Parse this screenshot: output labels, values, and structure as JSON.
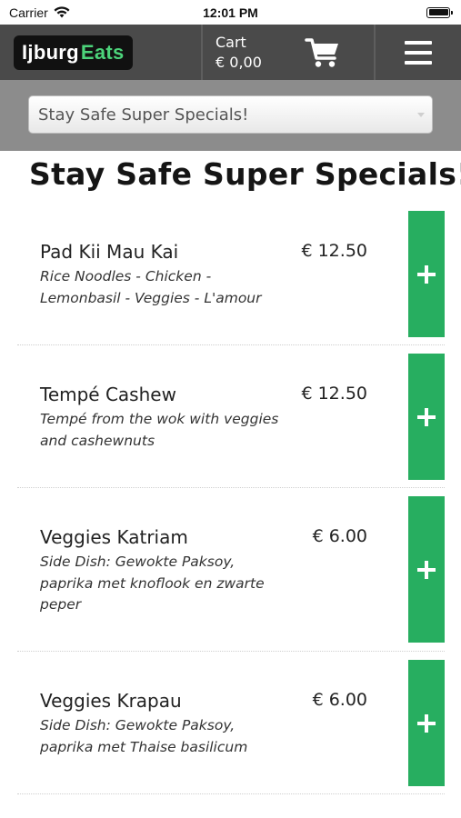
{
  "status_bar": {
    "carrier": "Carrier",
    "time": "12:01 PM"
  },
  "header": {
    "logo_part1": "Ijburg",
    "logo_part2": "Eats",
    "cart_label": "Cart",
    "cart_total": "€ 0,00",
    "icons": [
      "cart-icon",
      "menu-icon"
    ]
  },
  "category": {
    "selected": "Stay Safe Super Specials!"
  },
  "page_title": "Stay Safe Super Specials!",
  "products": [
    {
      "name": "Pad Kii Mau Kai",
      "desc_lines": [
        "Rice Noodles - Chicken -",
        "Lemonbasil - Veggies - L'amour"
      ],
      "price": "€ 12.50"
    },
    {
      "name": "Tempé Cashew",
      "desc_lines": [
        "Tempé from the wok with veggies",
        "and cashewnuts"
      ],
      "price": "€ 12.50"
    },
    {
      "name": "Veggies Katriam",
      "desc_lines": [
        "Side Dish: Gewokte Paksoy,",
        "paprika met knoflook en zwarte",
        "peper"
      ],
      "price": "€ 6.00"
    },
    {
      "name": "Veggies Krapau",
      "desc_lines": [
        "Side Dish: Gewokte Paksoy,",
        "paprika met Thaise basilicum"
      ],
      "price": "€ 6.00"
    }
  ],
  "colors": {
    "header_bg": "#4a4a4a",
    "category_bar_bg": "#8c8c8c",
    "add_button": "#27ae60",
    "logo_accent": "#4cd37a"
  }
}
